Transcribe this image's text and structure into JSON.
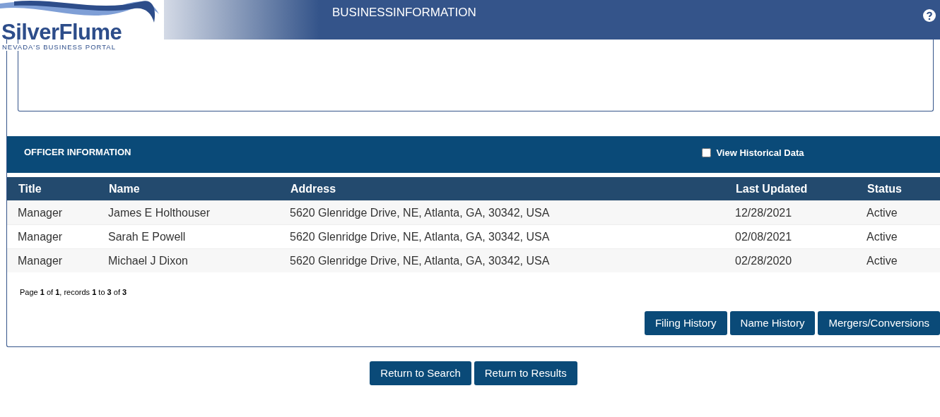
{
  "header": {
    "logo_name": "SilverFlume",
    "logo_tagline": "NEVADA'S BUSINESS PORTAL",
    "title": "BUSINESSINFORMATION"
  },
  "officers": {
    "title": "OFFICER INFORMATION",
    "historical": {
      "label": "View Historical Data",
      "checked": false
    },
    "columns": [
      "Title",
      "Name",
      "Address",
      "Last Updated",
      "Status"
    ],
    "rows": [
      {
        "cells": [
          "Manager",
          "James E Holthouser",
          "5620 Glenridge Drive, NE, Atlanta, GA, 30342, USA",
          "12/28/2021",
          "Active"
        ]
      },
      {
        "cells": [
          "Manager",
          "Sarah E Powell",
          "5620 Glenridge Drive, NE, Atlanta, GA, 30342, USA",
          "02/08/2021",
          "Active"
        ]
      },
      {
        "cells": [
          "Manager",
          "Michael J Dixon",
          "5620 Glenridge Drive, NE, Atlanta, GA, 30342, USA",
          "02/28/2020",
          "Active"
        ]
      }
    ],
    "pager": "Page **1** of **1**, records **1** to **3** of **3**",
    "buttons": [
      "Filing History",
      "Name History",
      "Mergers/Conversions"
    ]
  },
  "footer_buttons": [
    "Return to Search",
    "Return to Results"
  ]
}
